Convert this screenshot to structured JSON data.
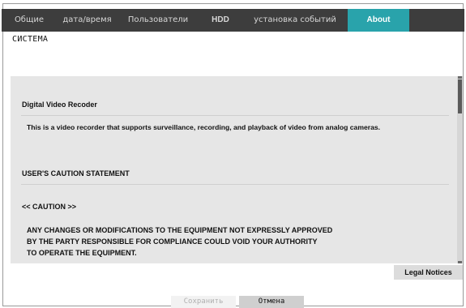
{
  "tabs": [
    {
      "label": "Общие"
    },
    {
      "label": "дата/время"
    },
    {
      "label": "Пользователи"
    },
    {
      "label": "HDD"
    },
    {
      "label": "установка событий"
    },
    {
      "label": "About",
      "active": true
    }
  ],
  "section_label": "СИСТЕМА",
  "content": {
    "product_title": "Digital Video Recoder",
    "description": "This is a video recorder that supports surveillance, recording, and playback of video from analog cameras.",
    "caution_heading": "USER'S CAUTION STATEMENT",
    "caution_tag": "<< CAUTION >>",
    "caution_lines": [
      "ANY CHANGES OR MODIFICATIONS TO THE EQUIPMENT NOT EXPRESSLY APPROVED",
      "BY THE PARTY RESPONSIBLE FOR COMPLIANCE COULD VOID YOUR AUTHORITY",
      "TO OPERATE THE EQUIPMENT."
    ]
  },
  "legal_button": "Legal Notices",
  "footer": {
    "save_label": "Сохранить",
    "cancel_label": "Отмена"
  },
  "colors": {
    "tabbar_bg": "#3d3d3d",
    "active_tab": "#29a3ab",
    "content_bg": "#e6e6e6"
  }
}
